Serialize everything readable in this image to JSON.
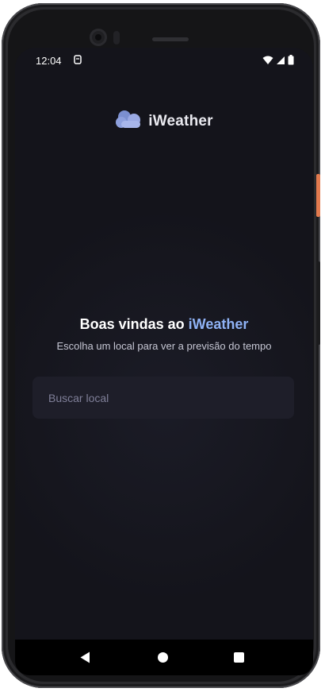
{
  "status_bar": {
    "time": "12:04",
    "icons": [
      "notification-icon",
      "wifi-icon",
      "signal-icon",
      "battery-icon"
    ]
  },
  "logo": {
    "text": "iWeather",
    "icon": "cloud-logo-icon"
  },
  "welcome": {
    "title_prefix": "Boas vindas ao ",
    "title_brand": "iWeather",
    "subtitle": "Escolha um local para ver a previsão do tempo"
  },
  "search": {
    "placeholder": "Buscar local",
    "value": ""
  },
  "nav_bar": {
    "buttons": [
      "back-icon",
      "home-icon",
      "recents-icon"
    ]
  },
  "colors": {
    "background": "#14141b",
    "accent": "#8fb2f5",
    "input_bg": "#1e1e29",
    "placeholder": "#7f7f98",
    "text": "#ffffff"
  }
}
